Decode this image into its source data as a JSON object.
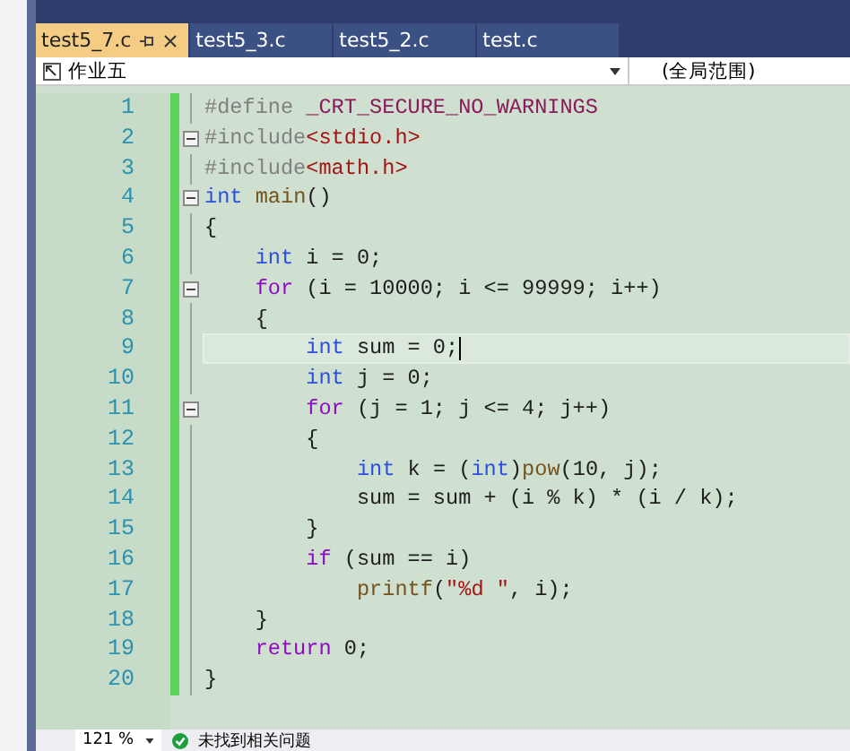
{
  "tabs": [
    {
      "label": "test5_7.c",
      "selected": true
    },
    {
      "label": "test5_3.c",
      "selected": false
    },
    {
      "label": "test5_2.c",
      "selected": false
    },
    {
      "label": "test.c",
      "selected": false
    }
  ],
  "navigation": {
    "scope": "作业五",
    "global_scope": "(全局范围)"
  },
  "code_lines": [
    {
      "number": "1",
      "fold": false,
      "current": false,
      "tokens": [
        {
          "kind": "pre",
          "text": "#define "
        },
        {
          "kind": "macro",
          "text": "_CRT_SECURE_NO_WARNINGS"
        }
      ]
    },
    {
      "number": "2",
      "fold": true,
      "current": false,
      "tokens": [
        {
          "kind": "pre",
          "text": "#include"
        },
        {
          "kind": "str",
          "text": "<stdio.h>"
        }
      ]
    },
    {
      "number": "3",
      "fold": false,
      "current": false,
      "tokens": [
        {
          "kind": "pre",
          "text": "#include"
        },
        {
          "kind": "str",
          "text": "<math.h>"
        }
      ]
    },
    {
      "number": "4",
      "fold": true,
      "current": false,
      "tokens": [
        {
          "kind": "type",
          "text": "int"
        },
        {
          "kind": "func",
          "text": " main"
        },
        {
          "kind": "plain",
          "text": "()"
        }
      ]
    },
    {
      "number": "5",
      "fold": false,
      "current": false,
      "tokens": [
        {
          "kind": "plain",
          "text": "{"
        }
      ]
    },
    {
      "number": "6",
      "fold": false,
      "current": false,
      "tokens": [
        {
          "kind": "type",
          "text": "    int"
        },
        {
          "kind": "plain",
          "text": " i = 0;"
        }
      ]
    },
    {
      "number": "7",
      "fold": true,
      "current": false,
      "tokens": [
        {
          "kind": "ctrl",
          "text": "    for"
        },
        {
          "kind": "plain",
          "text": " (i = 10000; i <= 99999; i++)"
        }
      ]
    },
    {
      "number": "8",
      "fold": false,
      "current": false,
      "tokens": [
        {
          "kind": "plain",
          "text": "    {"
        }
      ]
    },
    {
      "number": "9",
      "fold": false,
      "current": true,
      "tokens": [
        {
          "kind": "type",
          "text": "        int"
        },
        {
          "kind": "plain",
          "text": " sum = 0;"
        }
      ]
    },
    {
      "number": "10",
      "fold": false,
      "current": false,
      "tokens": [
        {
          "kind": "type",
          "text": "        int"
        },
        {
          "kind": "plain",
          "text": " j = 0;"
        }
      ]
    },
    {
      "number": "11",
      "fold": true,
      "current": false,
      "tokens": [
        {
          "kind": "ctrl",
          "text": "        for"
        },
        {
          "kind": "plain",
          "text": " (j = 1; j <= 4; j++)"
        }
      ]
    },
    {
      "number": "12",
      "fold": false,
      "current": false,
      "tokens": [
        {
          "kind": "plain",
          "text": "        {"
        }
      ]
    },
    {
      "number": "13",
      "fold": false,
      "current": false,
      "tokens": [
        {
          "kind": "type",
          "text": "            int"
        },
        {
          "kind": "plain",
          "text": " k = ("
        },
        {
          "kind": "type",
          "text": "int"
        },
        {
          "kind": "plain",
          "text": ")"
        },
        {
          "kind": "func",
          "text": "pow"
        },
        {
          "kind": "plain",
          "text": "(10, j);"
        }
      ]
    },
    {
      "number": "14",
      "fold": false,
      "current": false,
      "tokens": [
        {
          "kind": "plain",
          "text": "            sum = sum + (i % k) * (i / k);"
        }
      ]
    },
    {
      "number": "15",
      "fold": false,
      "current": false,
      "tokens": [
        {
          "kind": "plain",
          "text": "        }"
        }
      ]
    },
    {
      "number": "16",
      "fold": false,
      "current": false,
      "tokens": [
        {
          "kind": "ctrl",
          "text": "        if"
        },
        {
          "kind": "plain",
          "text": " (sum == i)"
        }
      ]
    },
    {
      "number": "17",
      "fold": false,
      "current": false,
      "tokens": [
        {
          "kind": "func",
          "text": "            printf"
        },
        {
          "kind": "plain",
          "text": "("
        },
        {
          "kind": "str",
          "text": "\"%d \""
        },
        {
          "kind": "plain",
          "text": ", i);"
        }
      ]
    },
    {
      "number": "18",
      "fold": false,
      "current": false,
      "tokens": [
        {
          "kind": "plain",
          "text": "    }"
        }
      ]
    },
    {
      "number": "19",
      "fold": false,
      "current": false,
      "tokens": [
        {
          "kind": "ctrl",
          "text": "    return"
        },
        {
          "kind": "plain",
          "text": " 0;"
        }
      ]
    },
    {
      "number": "20",
      "fold": false,
      "current": false,
      "tokens": [
        {
          "kind": "plain",
          "text": "}"
        }
      ]
    }
  ],
  "status_bar": {
    "zoom": "121 %",
    "message": "未找到相关问题"
  }
}
